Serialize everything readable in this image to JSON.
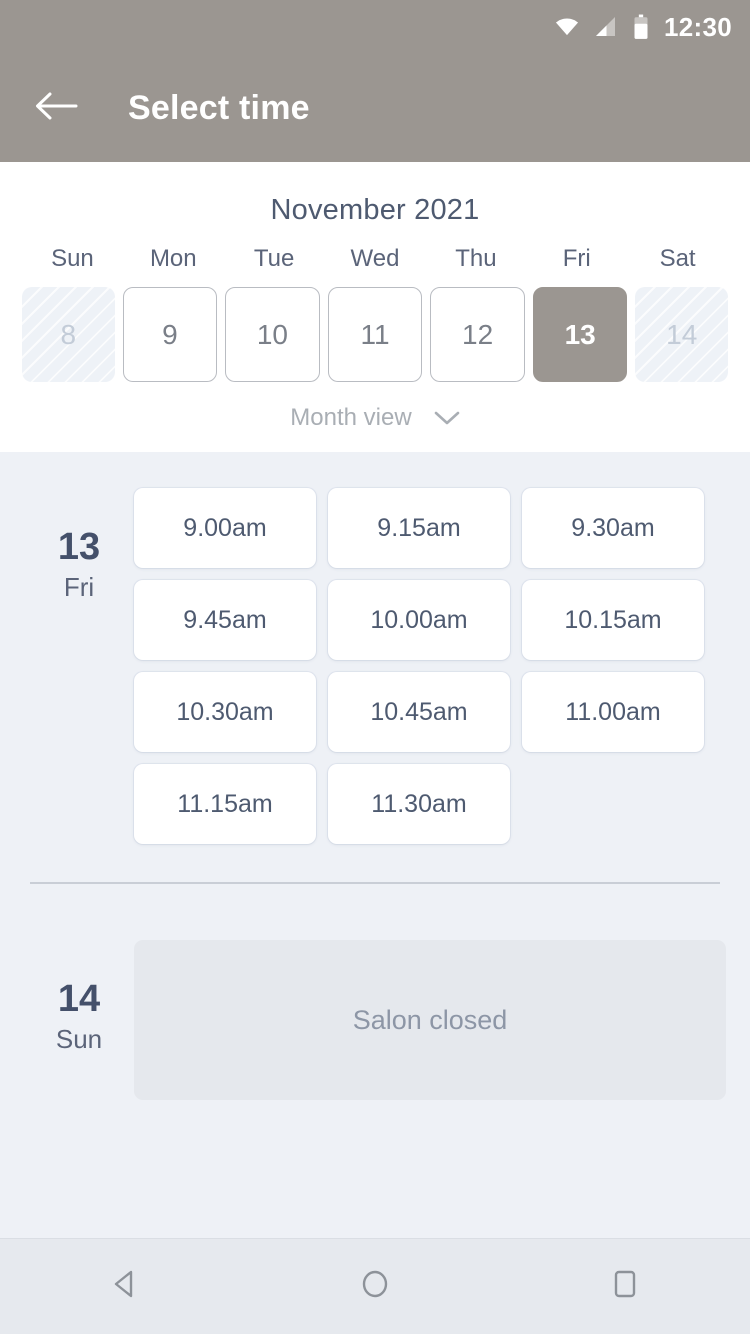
{
  "status_bar": {
    "time": "12:30",
    "icons": [
      "wifi-icon",
      "signal-icon",
      "battery-icon"
    ]
  },
  "app_bar": {
    "back_icon": "back-arrow-icon",
    "title": "Select time"
  },
  "calendar": {
    "month_title": "November 2021",
    "weekdays": [
      "Sun",
      "Mon",
      "Tue",
      "Wed",
      "Thu",
      "Fri",
      "Sat"
    ],
    "dates": [
      {
        "label": "8",
        "state": "disabled"
      },
      {
        "label": "9",
        "state": "enabled"
      },
      {
        "label": "10",
        "state": "enabled"
      },
      {
        "label": "11",
        "state": "enabled"
      },
      {
        "label": "12",
        "state": "enabled"
      },
      {
        "label": "13",
        "state": "selected"
      },
      {
        "label": "14",
        "state": "disabled"
      }
    ],
    "month_view_label": "Month view",
    "month_view_icon": "chevron-down-icon"
  },
  "schedule": [
    {
      "day_number": "13",
      "day_name": "Fri",
      "slots": [
        "9.00am",
        "9.15am",
        "9.30am",
        "9.45am",
        "10.00am",
        "10.15am",
        "10.30am",
        "10.45am",
        "11.00am",
        "11.15am",
        "11.30am"
      ],
      "closed_message": null
    },
    {
      "day_number": "14",
      "day_name": "Sun",
      "slots": [],
      "closed_message": "Salon closed"
    }
  ],
  "nav_bar": {
    "back_icon": "nav-back-triangle-icon",
    "home_icon": "nav-home-circle-icon",
    "recents_icon": "nav-recents-square-icon"
  },
  "colors": {
    "appbar": "#9b9691",
    "selected_date": "#9b9691",
    "body_bg": "#eef1f6",
    "text_primary": "#4e5a70",
    "text_muted": "#8d96a6",
    "closed_block": "#e5e8ed"
  }
}
